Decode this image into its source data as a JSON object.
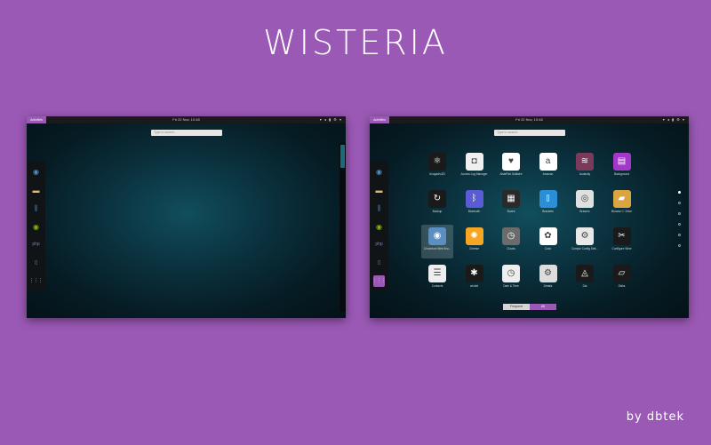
{
  "page": {
    "title": "WISTERIA",
    "credit": "by dbtek",
    "background": "#9b59b6",
    "accent": "#9b59b6"
  },
  "topbar": {
    "activities": "Activities",
    "clock": "Fri 22 Nov, 10:48",
    "tray": "▾ ◂ ▮ ⚙ ▾"
  },
  "search": {
    "placeholder": "Type to search..."
  },
  "dash": {
    "items": [
      {
        "icon": "chromium-icon",
        "glyph": "◉",
        "color": "#4f8fcf"
      },
      {
        "icon": "files-icon",
        "glyph": "▬",
        "color": "#d9b979"
      },
      {
        "icon": "mixer-icon",
        "glyph": "⫼",
        "color": "#3a7ec4"
      },
      {
        "icon": "spotify-icon",
        "glyph": "◉",
        "color": "#84bd00"
      },
      {
        "icon": "php-icon",
        "glyph": "php",
        "color": "#7b7fb5"
      },
      {
        "icon": "brackets-icon",
        "glyph": "[]",
        "color": "#2d8ed8"
      },
      {
        "icon": "app-grid-icon",
        "glyph": "⋮⋮⋮",
        "color": "#ffffff"
      }
    ]
  },
  "apps": [
    {
      "label": "Avogadro2D",
      "icon": "avogadro-icon",
      "glyph": "⚛",
      "bg": "#1a1a1a"
    },
    {
      "label": "Access Log Manager",
      "icon": "mask-icon",
      "glyph": "◘",
      "bg": "#f0f0f0"
    },
    {
      "label": "AisleRiot Solitaire",
      "icon": "cards-icon",
      "glyph": "♥",
      "bg": "#ffffff"
    },
    {
      "label": "Amazon",
      "icon": "amazon-icon",
      "glyph": "a",
      "bg": "#ffffff"
    },
    {
      "label": "Audacity",
      "icon": "audacity-icon",
      "glyph": "≋",
      "bg": "#7a3a5a"
    },
    {
      "label": "Background",
      "icon": "background-icon",
      "glyph": "▤",
      "bg": "#a237c8"
    },
    {
      "label": "Backup",
      "icon": "backup-icon",
      "glyph": "↻",
      "bg": "#1a1a1a"
    },
    {
      "label": "Bluetooth",
      "icon": "bluetooth-icon",
      "glyph": "ᛒ",
      "bg": "#5b5bd6"
    },
    {
      "label": "Boxes",
      "icon": "boxes-icon",
      "glyph": "▦",
      "bg": "#2a2a2a"
    },
    {
      "label": "Brackets",
      "icon": "brackets-app-icon",
      "glyph": "[]",
      "bg": "#2d8ed8"
    },
    {
      "label": "Brasero",
      "icon": "brasero-icon",
      "glyph": "◎",
      "bg": "#e0e0e0"
    },
    {
      "label": "Browse C: Drive",
      "icon": "folder-icon",
      "glyph": "▰",
      "bg": "#d9a441"
    },
    {
      "label": "Chromium Web Bro...",
      "icon": "chromium-app-icon",
      "glyph": "◉",
      "bg": "#5a8fc0"
    },
    {
      "label": "Cheese",
      "icon": "cheese-icon",
      "glyph": "✺",
      "bg": "#f5a623"
    },
    {
      "label": "Clocks",
      "icon": "clocks-icon",
      "glyph": "◷",
      "bg": "#6b6b6b"
    },
    {
      "label": "Color",
      "icon": "color-icon",
      "glyph": "✿",
      "bg": "#ffffff"
    },
    {
      "label": "Compiz Config Sett...",
      "icon": "compiz-icon",
      "glyph": "⚙",
      "bg": "#e8e8e8"
    },
    {
      "label": "Configure Wine",
      "icon": "wine-icon",
      "glyph": "✂",
      "bg": "#1a1a1a"
    },
    {
      "label": "Contacts",
      "icon": "contacts-icon",
      "glyph": "☰",
      "bg": "#eeeeee"
    },
    {
      "label": "cricket",
      "icon": "cricket-icon",
      "glyph": "✱",
      "bg": "#1a1a1a"
    },
    {
      "label": "Date & Time",
      "icon": "date-time-icon",
      "glyph": "◷",
      "bg": "#eeeeee"
    },
    {
      "label": "Details",
      "icon": "details-icon",
      "glyph": "⚙",
      "bg": "#dddddd"
    },
    {
      "label": "Dia",
      "icon": "dia-icon",
      "glyph": "◬",
      "bg": "#1a1a1a"
    },
    {
      "label": "Disks",
      "icon": "disks-icon",
      "glyph": "▱",
      "bg": "#1a1a1a"
    }
  ],
  "switcher": {
    "frequent": "Frequent",
    "all": "All"
  }
}
